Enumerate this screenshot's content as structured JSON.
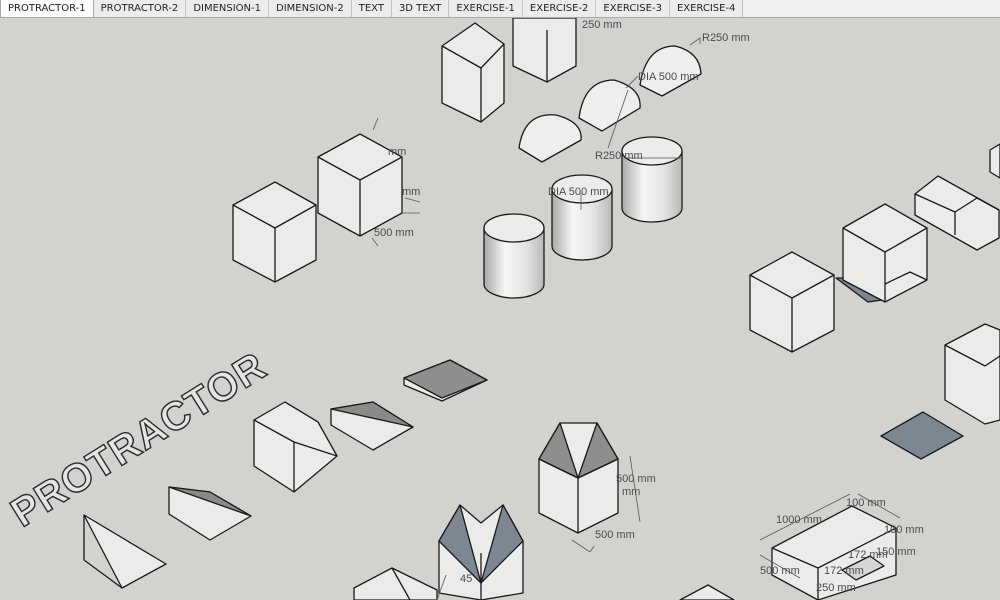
{
  "tabs": [
    {
      "label": "PROTRACTOR-1",
      "active": true
    },
    {
      "label": "PROTRACTOR-2",
      "active": false
    },
    {
      "label": "DIMENSION-1",
      "active": false
    },
    {
      "label": "DIMENSION-2",
      "active": false
    },
    {
      "label": "TEXT",
      "active": false
    },
    {
      "label": "3D TEXT",
      "active": false
    },
    {
      "label": "EXERCISE-1",
      "active": false
    },
    {
      "label": "EXERCISE-2",
      "active": false
    },
    {
      "label": "EXERCISE-3",
      "active": false
    },
    {
      "label": "EXERCISE-4",
      "active": false
    }
  ],
  "scene": {
    "text3d": "PROTRACTOR",
    "dimensions": {
      "d_250_top": "250 mm",
      "r250_top": "R250 mm",
      "dia500_top": "DIA 500 mm",
      "r250_mid": "R250 mm",
      "dia500_mid": "DIA 500 mm",
      "cube_500": "500 mm",
      "cube_mm_1": "mm",
      "cube_mm_2": "mm",
      "hex_500_a": "500 mm",
      "hex_mm": "mm",
      "hex_500_b": "500 mm",
      "angle_45": "45",
      "br_1000": "1000 mm",
      "br_100a": "100 mm",
      "br_100b": "100 mm",
      "br_150": "150 mm",
      "br_172a": "172 mm",
      "br_172b": "172 mm",
      "br_500": "500 mm",
      "br_250": "250 mm"
    }
  },
  "colors": {
    "canvas": "#d2d2cf",
    "face_light": "#ebebe9",
    "face_mid": "#dcdcda",
    "face_dark": "#878787",
    "face_slate": "#7c8791"
  }
}
